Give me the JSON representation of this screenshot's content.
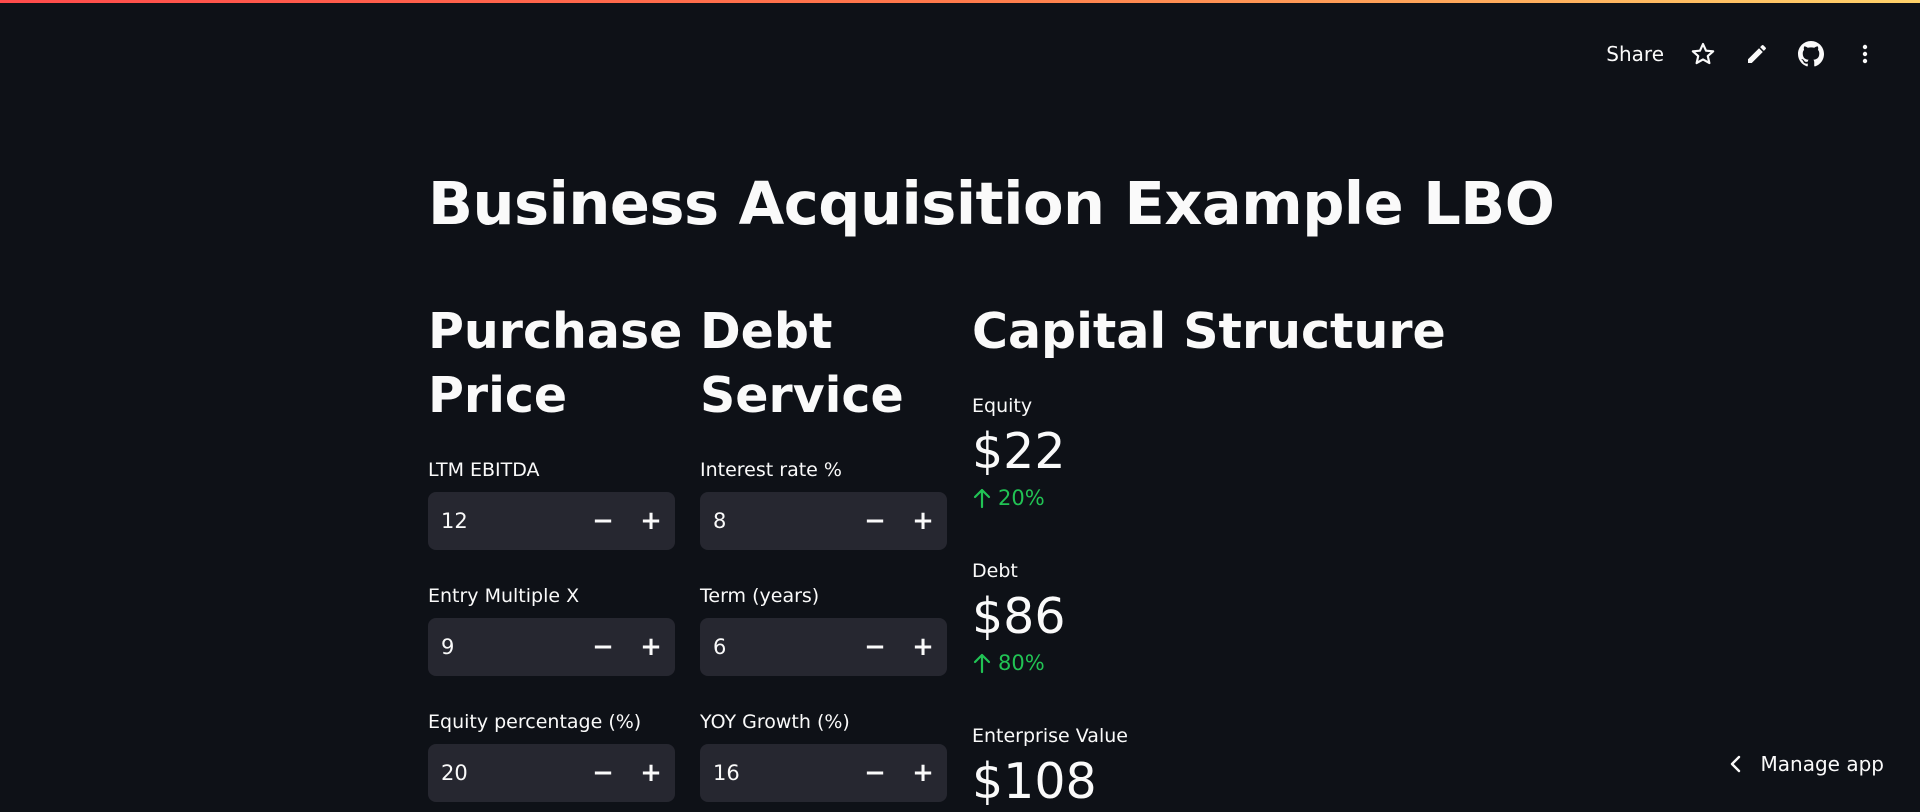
{
  "header": {
    "share_label": "Share",
    "icons": [
      "star-icon",
      "pencil-icon",
      "github-icon",
      "more-vertical-icon"
    ]
  },
  "title": "Business Acquisition Example LBO",
  "purchase_price": {
    "heading": "Purchase Price",
    "fields": [
      {
        "label": "LTM EBITDA",
        "value": "12"
      },
      {
        "label": "Entry Multiple X",
        "value": "9"
      },
      {
        "label": "Equity percentage (%)",
        "value": "20"
      }
    ]
  },
  "debt_service": {
    "heading": "Debt Service",
    "fields": [
      {
        "label": "Interest rate %",
        "value": "8"
      },
      {
        "label": "Term (years)",
        "value": "6"
      },
      {
        "label": "YOY Growth (%)",
        "value": "16"
      }
    ]
  },
  "capital_structure": {
    "heading": "Capital Structure",
    "metrics": [
      {
        "label": "Equity",
        "value": "$22",
        "delta": "20%"
      },
      {
        "label": "Debt",
        "value": "$86",
        "delta": "80%"
      },
      {
        "label": "Enterprise Value",
        "value": "$108"
      }
    ]
  },
  "stepper": {
    "minus": "−",
    "plus": "+"
  },
  "footer": {
    "manage_app_label": "Manage app"
  },
  "colors": {
    "background": "#0e1117",
    "input_bg": "#262730",
    "delta_positive": "#21c354",
    "accent_gradient_start": "#ff4b4b",
    "accent_gradient_end": "#ffd26a"
  }
}
